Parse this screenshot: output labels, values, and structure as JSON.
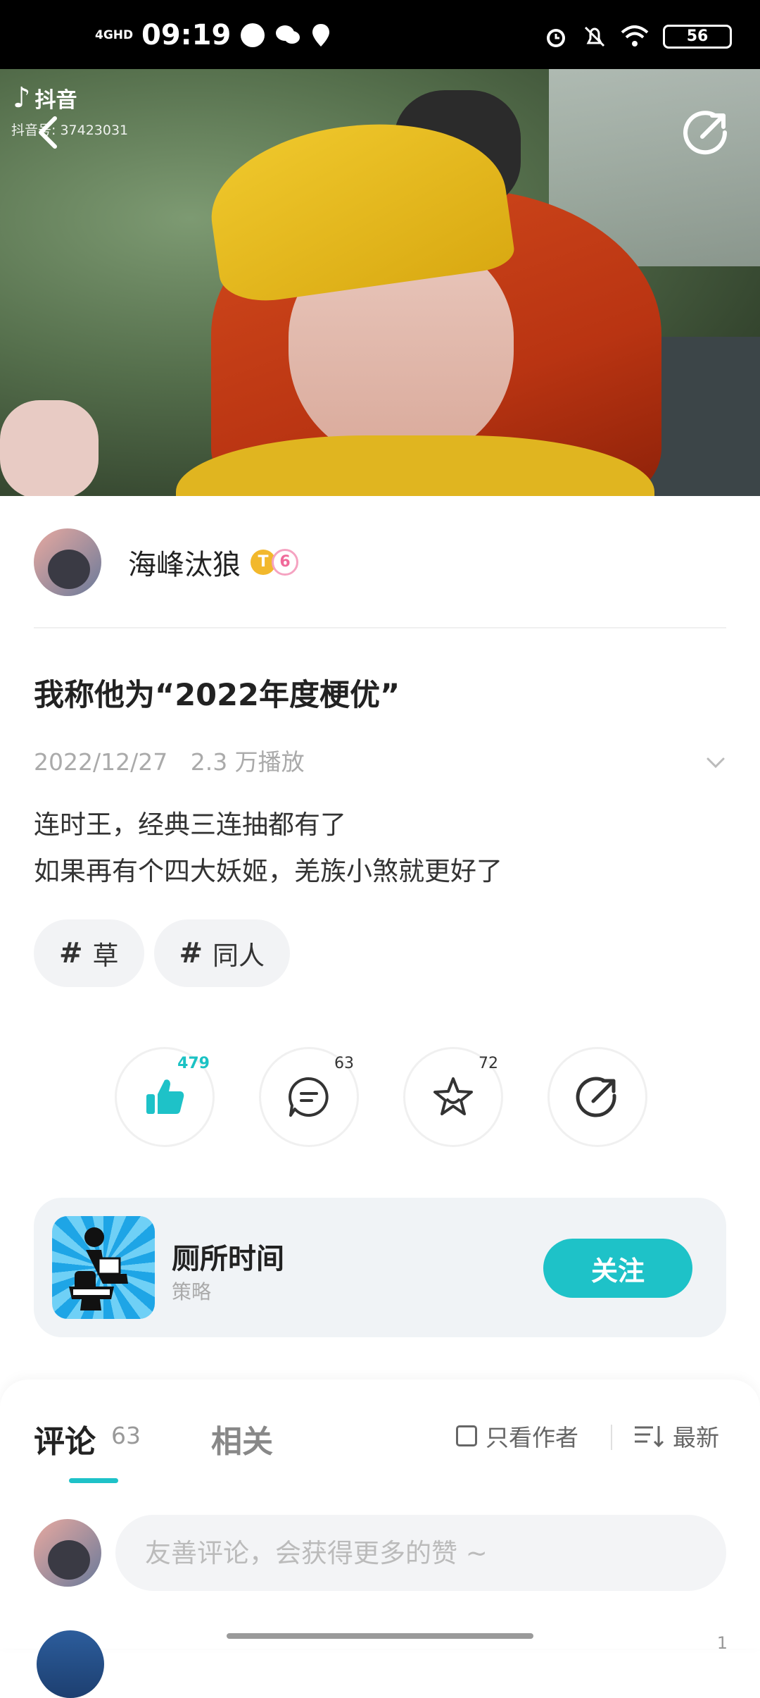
{
  "status_bar": {
    "network": "4GHD",
    "time": "09:19",
    "battery": "56"
  },
  "video": {
    "watermark_app": "抖音",
    "watermark_id": "抖音号: 37423031"
  },
  "author": {
    "name": "海峰汰狼",
    "badge_level": "T",
    "badge_rank": "6"
  },
  "post": {
    "title": "我称他为“2022年度梗优”",
    "date": "2022/12/27",
    "views": "2.3 万播放",
    "description_line1": "连时王，经典三连抽都有了",
    "description_line2": "如果再有个四大妖姬，羌族小煞就更好了"
  },
  "tags": [
    {
      "hash": "#",
      "label": "草"
    },
    {
      "hash": "#",
      "label": "同人"
    }
  ],
  "actions": {
    "like_count": "479",
    "comment_count": "63",
    "favorite_count": "72"
  },
  "channel": {
    "name": "厕所时间",
    "subtitle": "策略",
    "follow_label": "关注"
  },
  "comments": {
    "tab_comments": "评论",
    "tab_comments_count": "63",
    "tab_related": "相关",
    "only_author_label": "只看作者",
    "sort_label": "最新",
    "input_placeholder": "友善评论，会获得更多的赞 ~",
    "next_item_count": "1"
  },
  "colors": {
    "accent": "#1ec2c8",
    "status_bar_bg": "#000000"
  }
}
